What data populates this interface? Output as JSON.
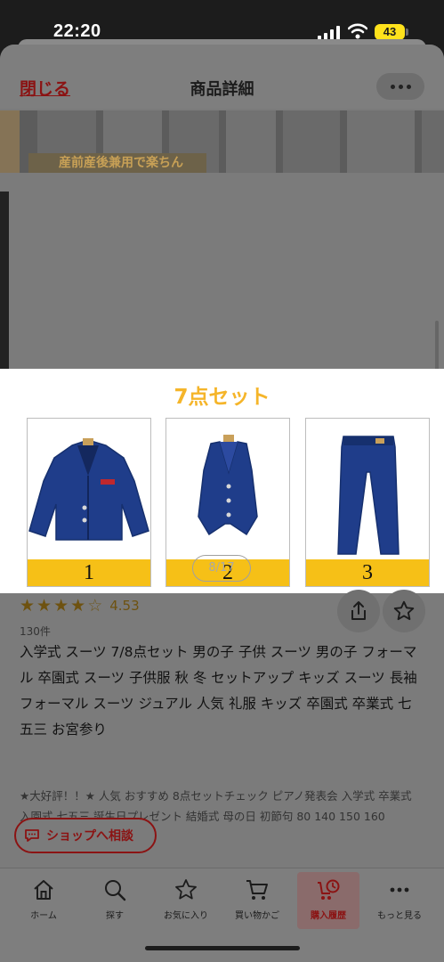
{
  "status_bar": {
    "time": "22:20",
    "battery": "43"
  },
  "header": {
    "close_label": "閉じる",
    "title": "商品詳細"
  },
  "banner": {
    "caption": "産前産後兼用で楽ちん"
  },
  "panel": {
    "title": "7点セット",
    "items": [
      {
        "number": "1",
        "icon": "jacket-icon"
      },
      {
        "number": "2",
        "icon": "vest-icon"
      },
      {
        "number": "3",
        "icon": "pants-icon"
      }
    ]
  },
  "gallery": {
    "page_indicator": "8/17"
  },
  "product": {
    "rating": "4.53",
    "stars": 4.5,
    "review_count": "130件",
    "title": "入学式 スーツ 7/8点セット 男の子 子供 スーツ 男の子 フォーマル 卒園式 スーツ 子供服 秋 冬 セットアップ キッズ スーツ 長袖 フォーマル スーツ ジュアル 人気 礼服 キッズ 卒園式 卒業式 七五三 お宮参り",
    "description": "★大好評！！★ 人気 おすすめ 8点セットチェック ピアノ発表会 入学式 卒業式 入園式 七五三 誕生日プレゼント 結婚式 母の日 初節句 80 140 150 160 170cm"
  },
  "chat_button": {
    "label": "ショップへ相談"
  },
  "tabbar": {
    "items": [
      {
        "label": "ホーム",
        "icon": "home-icon"
      },
      {
        "label": "探す",
        "icon": "search-icon"
      },
      {
        "label": "お気に入り",
        "icon": "star-icon"
      },
      {
        "label": "買い物かご",
        "icon": "cart-icon"
      },
      {
        "label": "購入履歴",
        "icon": "history-cart-icon",
        "active": true
      },
      {
        "label": "もっと見る",
        "icon": "more-icon"
      }
    ]
  },
  "colors": {
    "accent": "#8b1313",
    "panel_title": "#f5b52a",
    "number_bar": "#f6c017",
    "suit_blue": "#1f3d8a"
  }
}
